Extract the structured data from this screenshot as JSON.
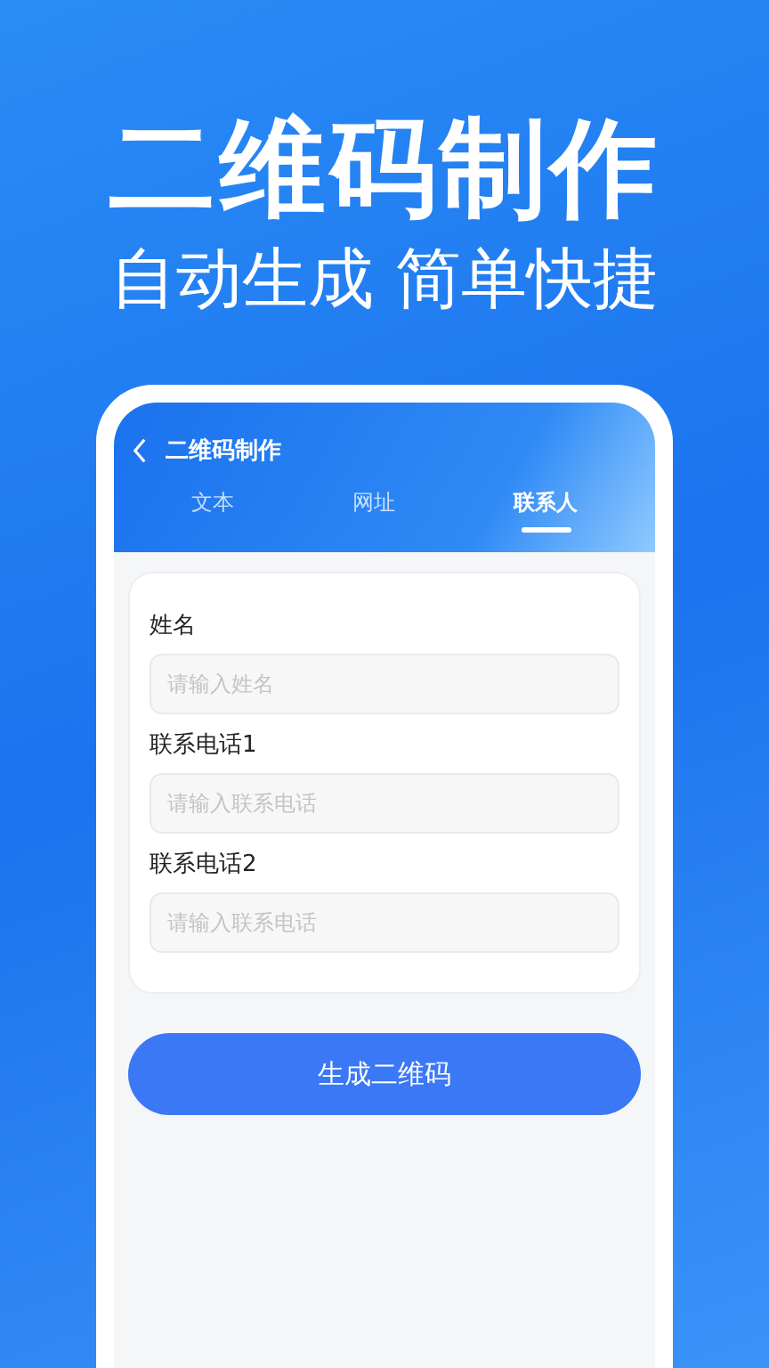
{
  "headline": "二维码制作",
  "subheadline": "自动生成 简单快捷",
  "screen_title": "二维码制作",
  "tabs": [
    {
      "label": "文本",
      "selected": false
    },
    {
      "label": "网址",
      "selected": false
    },
    {
      "label": "联系人",
      "selected": true
    }
  ],
  "fields": [
    {
      "label": "姓名",
      "placeholder": "请输入姓名"
    },
    {
      "label": "联系电话1",
      "placeholder": "请输入联系电话"
    },
    {
      "label": "联系电话2",
      "placeholder": "请输入联系电话"
    }
  ],
  "generate_button": "生成二维码"
}
